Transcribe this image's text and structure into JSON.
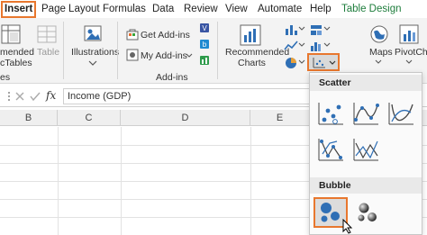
{
  "tabs": [
    {
      "label": "Insert"
    },
    {
      "label": "Page Layout"
    },
    {
      "label": "Formulas"
    },
    {
      "label": "Data"
    },
    {
      "label": "Review"
    },
    {
      "label": "View"
    },
    {
      "label": "Automate"
    },
    {
      "label": "Help"
    },
    {
      "label": "Table Design"
    }
  ],
  "ribbon": {
    "recommended_pivot": "mended",
    "recommended_pivot_line2": "cTables",
    "table_label": "Table",
    "illustrations_label": "Illustrations",
    "get_addins_label": "Get Add-ins",
    "my_addins_label": "My Add-ins",
    "addins_group_label": "Add-ins",
    "recommended_charts_line1": "Recommended",
    "recommended_charts_line2": "Charts",
    "maps_label": "Maps",
    "pivotchart_label": "PivotCha",
    "tables_group_label": "es"
  },
  "formula_bar": {
    "fx_label": "fx",
    "content": "Income (GDP)"
  },
  "columns": [
    {
      "label": "B"
    },
    {
      "label": "C"
    },
    {
      "label": "D"
    },
    {
      "label": "E"
    }
  ],
  "dropdown": {
    "scatter_heading": "Scatter",
    "bubble_heading": "Bubble"
  },
  "colors": {
    "highlight": "#e8772e",
    "accent_green": "#1e7d3c",
    "chart_blue": "#2f6fb5"
  }
}
